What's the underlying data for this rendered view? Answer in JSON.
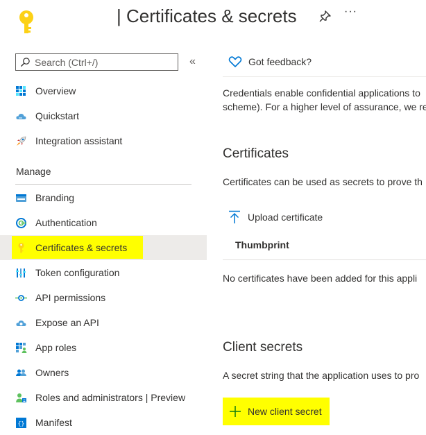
{
  "header": {
    "title": "| Certificates & secrets",
    "more": "···"
  },
  "sidebar": {
    "search_placeholder": "Search (Ctrl+/)",
    "collapse": "«",
    "items_top": [
      {
        "label": "Overview",
        "icon": "overview-grid-icon"
      },
      {
        "label": "Quickstart",
        "icon": "quickstart-cloud-icon"
      },
      {
        "label": "Integration assistant",
        "icon": "rocket-icon"
      }
    ],
    "manage_heading": "Manage",
    "items_manage": [
      {
        "label": "Branding",
        "icon": "branding-icon"
      },
      {
        "label": "Authentication",
        "icon": "authentication-icon"
      },
      {
        "label": "Certificates & secrets",
        "icon": "key-icon",
        "selected": true
      },
      {
        "label": "Token configuration",
        "icon": "token-bars-icon"
      },
      {
        "label": "API permissions",
        "icon": "api-permissions-icon"
      },
      {
        "label": "Expose an API",
        "icon": "expose-api-cloud-icon"
      },
      {
        "label": "App roles",
        "icon": "app-roles-icon"
      },
      {
        "label": "Owners",
        "icon": "owners-icon"
      },
      {
        "label": "Roles and administrators | Preview",
        "icon": "roles-admins-icon"
      },
      {
        "label": "Manifest",
        "icon": "manifest-icon"
      }
    ]
  },
  "main": {
    "feedback": "Got feedback?",
    "intro_line1": "Credentials enable confidential applications to",
    "intro_line2": "scheme). For a higher level of assurance, we re",
    "certificates": {
      "heading": "Certificates",
      "description": "Certificates can be used as secrets to prove th",
      "upload_label": "Upload certificate",
      "column_thumbprint": "Thumbprint",
      "empty_text": "No certificates have been added for this appli"
    },
    "client_secrets": {
      "heading": "Client secrets",
      "description": "A secret string that the application uses to pro",
      "new_secret_label": "New client secret"
    }
  },
  "colors": {
    "highlight": "#ffff00",
    "selected_bg": "#edebe9",
    "accent_blue": "#0078d4",
    "key_yellow": "#fcd116"
  }
}
